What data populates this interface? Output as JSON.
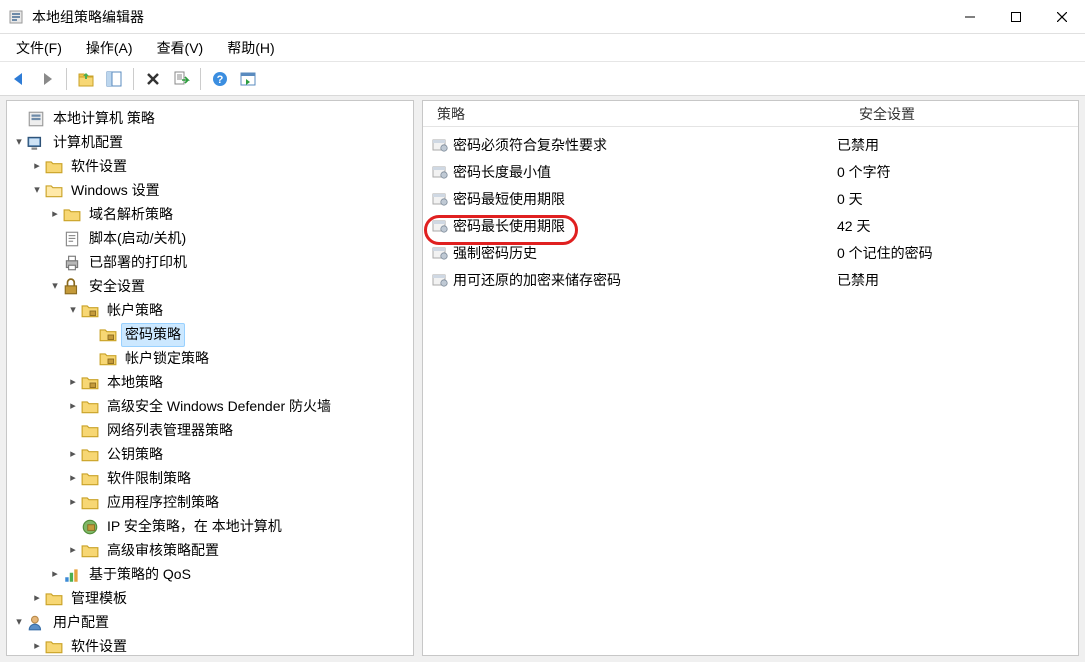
{
  "window": {
    "title": "本地组策略编辑器"
  },
  "menu": {
    "file": "文件(F)",
    "action": "操作(A)",
    "view": "查看(V)",
    "help": "帮助(H)"
  },
  "toolbar_icons": {
    "back": "back-icon",
    "forward": "forward-icon",
    "up": "up-icon",
    "show_hide": "show-hide-tree-icon",
    "delete": "delete-icon",
    "export": "export-list-icon",
    "help": "help-icon",
    "properties": "properties-icon"
  },
  "tree": {
    "root": "本地计算机 策略",
    "computer_config": "计算机配置",
    "software_settings": "软件设置",
    "windows_settings": "Windows 设置",
    "dns_policy": "域名解析策略",
    "scripts": "脚本(启动/关机)",
    "deployed_printers": "已部署的打印机",
    "security_settings": "安全设置",
    "account_policies": "帐户策略",
    "password_policy": "密码策略",
    "lockout_policy": "帐户锁定策略",
    "local_policies": "本地策略",
    "defender_firewall": "高级安全 Windows Defender 防火墙",
    "network_list_mgr": "网络列表管理器策略",
    "public_key": "公钥策略",
    "software_restrict": "软件限制策略",
    "app_control": "应用程序控制策略",
    "ip_security": "IP 安全策略，在 本地计算机",
    "adv_audit": "高级审核策略配置",
    "qos": "基于策略的 QoS",
    "admin_templates": "管理模板",
    "user_config": "用户配置",
    "user_software_settings": "软件设置"
  },
  "list": {
    "header_policy": "策略",
    "header_setting": "安全设置",
    "rows": [
      {
        "policy": "密码必须符合复杂性要求",
        "setting": "已禁用"
      },
      {
        "policy": "密码长度最小值",
        "setting": "0 个字符"
      },
      {
        "policy": "密码最短使用期限",
        "setting": "0 天"
      },
      {
        "policy": "密码最长使用期限",
        "setting": "42 天"
      },
      {
        "policy": "强制密码历史",
        "setting": "0 个记住的密码"
      },
      {
        "policy": "用可还原的加密来储存密码",
        "setting": "已禁用"
      }
    ],
    "highlighted_row_index": 3
  }
}
